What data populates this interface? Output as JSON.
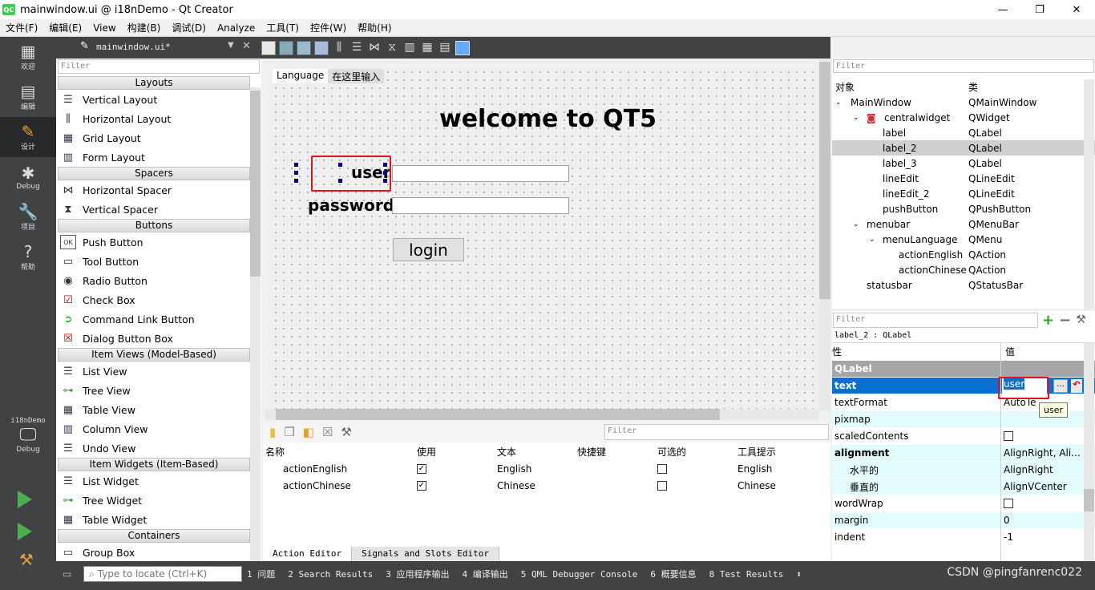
{
  "window": {
    "title": "mainwindow.ui @ i18nDemo - Qt Creator",
    "logo": "QC",
    "minimize": "—",
    "maximize": "❐",
    "close": "✕"
  },
  "menu": [
    "文件(F)",
    "编辑(E)",
    "View",
    "构建(B)",
    "调试(D)",
    "Analyze",
    "工具(T)",
    "控件(W)",
    "帮助(H)"
  ],
  "modes": [
    {
      "label": "欢迎",
      "icon": "grid-icon"
    },
    {
      "label": "编辑",
      "icon": "edit-doc-icon"
    },
    {
      "label": "设计",
      "icon": "pencil-icon"
    },
    {
      "label": "Debug",
      "icon": "bug-icon"
    },
    {
      "label": "项目",
      "icon": "wrench-icon"
    },
    {
      "label": "帮助",
      "icon": "help-icon"
    }
  ],
  "kit": {
    "project": "i18nDemo",
    "label": "Debug"
  },
  "editor_tab": {
    "file": "mainwindow.ui*"
  },
  "widget_box": {
    "filter": "Filter",
    "categories": {
      "layouts": "Layouts",
      "spacers": "Spacers",
      "buttons": "Buttons",
      "item_views": "Item Views (Model-Based)",
      "item_widgets": "Item Widgets (Item-Based)",
      "containers": "Containers"
    },
    "items": {
      "vertical_layout": "Vertical Layout",
      "horizontal_layout": "Horizontal Layout",
      "grid_layout": "Grid Layout",
      "form_layout": "Form Layout",
      "horizontal_spacer": "Horizontal Spacer",
      "vertical_spacer": "Vertical Spacer",
      "push_button": "Push Button",
      "tool_button": "Tool Button",
      "radio_button": "Radio Button",
      "check_box": "Check Box",
      "command_link_button": "Command Link Button",
      "dialog_button_box": "Dialog Button Box",
      "list_view": "List View",
      "tree_view": "Tree View",
      "table_view": "Table View",
      "column_view": "Column View",
      "undo_view": "Undo View",
      "list_widget": "List Widget",
      "tree_widget": "Tree Widget",
      "table_widget": "Table Widget",
      "group_box": "Group Box"
    }
  },
  "form": {
    "menu": {
      "language": "Language",
      "type_here": "在这里输入"
    },
    "title": "welcome to QT5",
    "user_label": "user",
    "password_label": "password",
    "login_button": "login"
  },
  "action_editor": {
    "filter": "Filter",
    "headers": {
      "name": "名称",
      "used": "使用",
      "text": "文本",
      "shortcut": "快捷键",
      "checkable": "可选的",
      "tooltip": "工具提示"
    },
    "rows": [
      {
        "name": "actionEnglish",
        "used": true,
        "text": "English",
        "checkable": false,
        "tooltip": "English"
      },
      {
        "name": "actionChinese",
        "used": true,
        "text": "Chinese",
        "checkable": false,
        "tooltip": "Chinese"
      }
    ],
    "tabs": {
      "action_editor": "Action Editor",
      "signals_slots": "Signals and Slots Editor"
    }
  },
  "object_inspector": {
    "filter": "Filter",
    "headers": {
      "object": "对象",
      "class": "类"
    },
    "rows": [
      {
        "object": "MainWindow",
        "class": "QMainWindow"
      },
      {
        "object": "centralwidget",
        "class": "QWidget"
      },
      {
        "object": "label",
        "class": "QLabel"
      },
      {
        "object": "label_2",
        "class": "QLabel"
      },
      {
        "object": "label_3",
        "class": "QLabel"
      },
      {
        "object": "lineEdit",
        "class": "QLineEdit"
      },
      {
        "object": "lineEdit_2",
        "class": "QLineEdit"
      },
      {
        "object": "pushButton",
        "class": "QPushButton"
      },
      {
        "object": "menubar",
        "class": "QMenuBar"
      },
      {
        "object": "menuLanguage",
        "class": "QMenu"
      },
      {
        "object": "actionEnglish",
        "class": "QAction"
      },
      {
        "object": "actionChinese",
        "class": "QAction"
      },
      {
        "object": "statusbar",
        "class": "QStatusBar"
      }
    ]
  },
  "property_editor": {
    "filter": "Filter",
    "object_info": "label_2 : QLabel",
    "headers": {
      "property": "性",
      "value": "值"
    },
    "section": "QLabel",
    "text_value": "user",
    "ellipsis": "...",
    "tooltip": "user",
    "rows": {
      "text": "text",
      "textformat": "textFormat",
      "textformat_value": "AutoTe",
      "pixmap": "pixmap",
      "scaledcontents": "scaledContents",
      "alignment": "alignment",
      "alignment_value": "AlignRight, Ali...",
      "horizontal": "水平的",
      "horizontal_value": "AlignRight",
      "vertical": "垂直的",
      "vertical_value": "AlignVCenter",
      "wordwrap": "wordWrap",
      "margin": "margin",
      "margin_value": "0",
      "indent": "indent",
      "indent_value": "-1"
    }
  },
  "statusbar": {
    "locator": "Type to locate (Ctrl+K)",
    "tabs": [
      "1 问题",
      "2 Search Results",
      "3 应用程序输出",
      "4 编译输出",
      "5 QML Debugger Console",
      "6 概要信息",
      "8 Test Results"
    ],
    "watermark": "CSDN @pingfanrenc022"
  },
  "colors": {
    "accent": "#0078d7",
    "selection_blue": "#0a6fd0",
    "red_highlight": "#e0141e",
    "mode_bar": "#404244"
  }
}
